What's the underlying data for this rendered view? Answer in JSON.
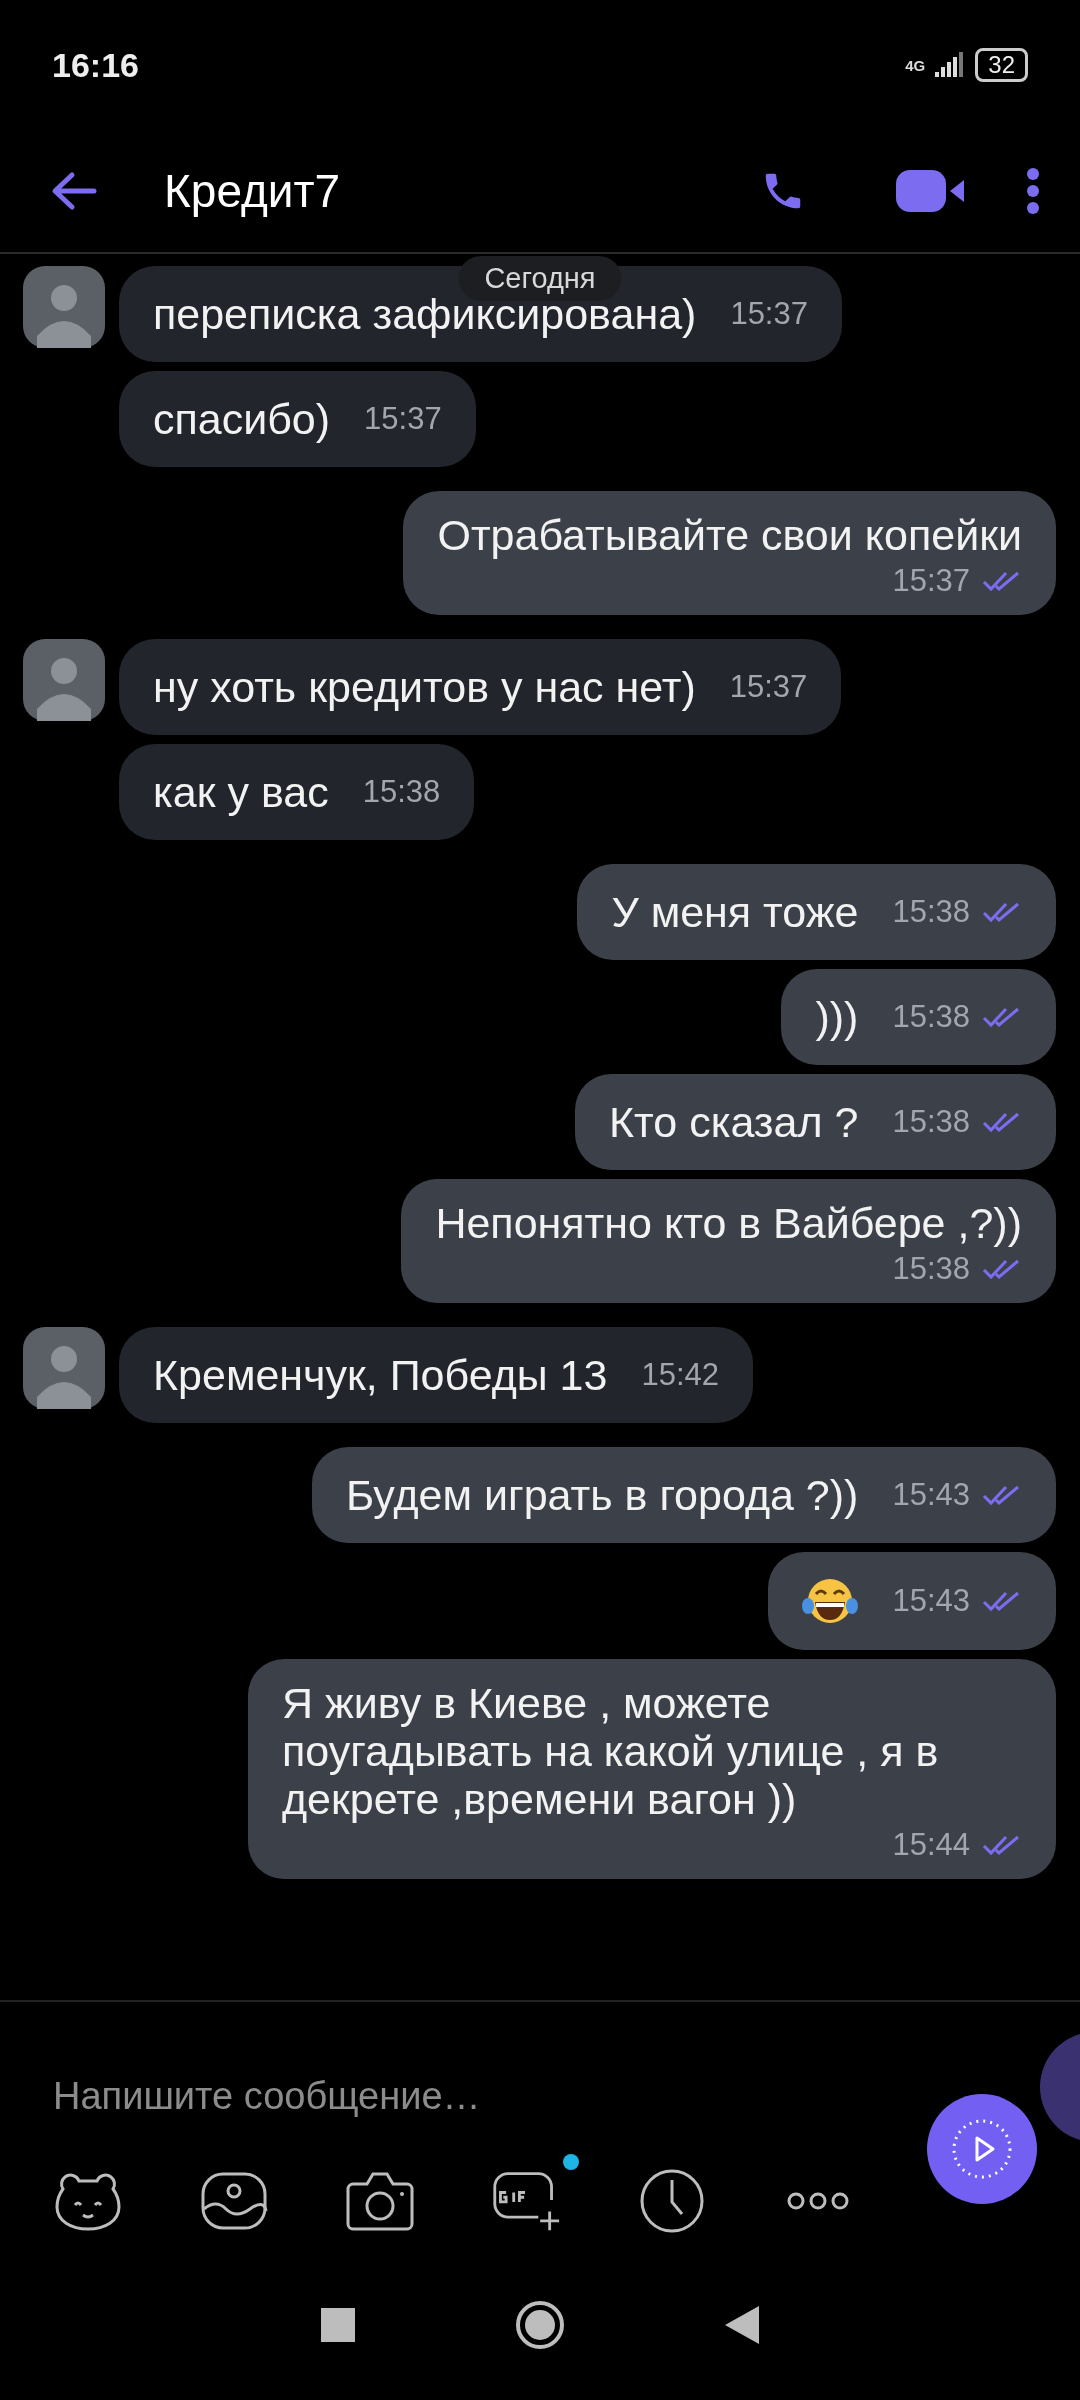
{
  "status_bar": {
    "time": "16:16",
    "network": "4G",
    "battery": "32"
  },
  "header": {
    "title": "Кредит7"
  },
  "date_label": "Сегодня",
  "messages": [
    {
      "outgoing": false,
      "kind": "short",
      "text": "переписка зафиксирована)",
      "time": "15:37"
    },
    {
      "outgoing": false,
      "kind": "short",
      "text": "спасибо)",
      "time": "15:37"
    },
    {
      "outgoing": true,
      "kind": "long",
      "text": "Отрабатывайте свои копейки",
      "time": "15:37",
      "read": true
    },
    {
      "outgoing": false,
      "kind": "short",
      "text": "ну хоть кредитов у нас нет)",
      "time": "15:37"
    },
    {
      "outgoing": false,
      "kind": "short",
      "text": "как у вас",
      "time": "15:38"
    },
    {
      "outgoing": true,
      "kind": "short",
      "text": "У меня тоже",
      "time": "15:38",
      "read": true
    },
    {
      "outgoing": true,
      "kind": "short",
      "text": ")))",
      "time": "15:38",
      "read": true
    },
    {
      "outgoing": true,
      "kind": "short",
      "text": "Кто сказал ?",
      "time": "15:38",
      "read": true
    },
    {
      "outgoing": true,
      "kind": "long",
      "text": "Непонятно кто в Вайбере ,?))",
      "time": "15:38",
      "read": true
    },
    {
      "outgoing": false,
      "kind": "short",
      "text": "Кременчук, Победы 13",
      "time": "15:42"
    },
    {
      "outgoing": true,
      "kind": "short",
      "text": "Будем играть в города ?))",
      "time": "15:43",
      "read": true
    },
    {
      "outgoing": true,
      "kind": "emoji",
      "time": "15:43",
      "read": true
    },
    {
      "outgoing": true,
      "kind": "long",
      "text": "Я живу в Киеве , можете поугадывать на какой улице , я в декрете ,времени вагон ))",
      "time": "15:44",
      "read": true
    }
  ],
  "composer": {
    "placeholder": "Напишите сообщение…",
    "gif_new": true
  }
}
